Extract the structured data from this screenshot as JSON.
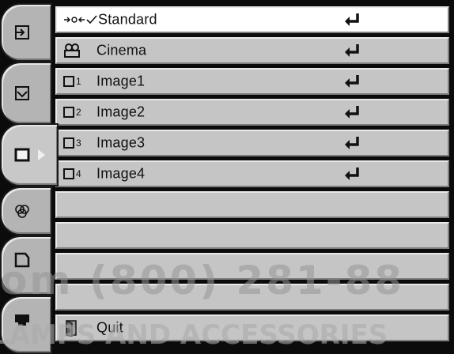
{
  "menu": {
    "items": [
      {
        "label": "Standard",
        "icon": "standard-icon",
        "selected": true
      },
      {
        "label": "Cinema",
        "icon": "cinema-icon"
      },
      {
        "label": "Image1",
        "icon": "image-box-icon",
        "num": "1"
      },
      {
        "label": "Image2",
        "icon": "image-box-icon",
        "num": "2"
      },
      {
        "label": "Image3",
        "icon": "image-box-icon",
        "num": "3"
      },
      {
        "label": "Image4",
        "icon": "image-box-icon",
        "num": "4"
      },
      {
        "label": ""
      },
      {
        "label": ""
      },
      {
        "label": ""
      },
      {
        "label": ""
      },
      {
        "label": "Quit",
        "icon": "quit-icon"
      }
    ]
  },
  "watermark": {
    "line1": "om (800) 281-88",
    "line2": "LAMPS AND ACCESSORIES"
  },
  "tabs": [
    {
      "icon": "input-icon"
    },
    {
      "icon": "picture-adjust-icon"
    },
    {
      "icon": "image-select-icon",
      "active": true
    },
    {
      "icon": "color-icon"
    },
    {
      "icon": "screen-icon"
    },
    {
      "icon": "setting-icon"
    }
  ],
  "colors": {
    "row": "#c5c5c5",
    "selected_row": "#ffffff",
    "background": "#0b0b0b"
  }
}
